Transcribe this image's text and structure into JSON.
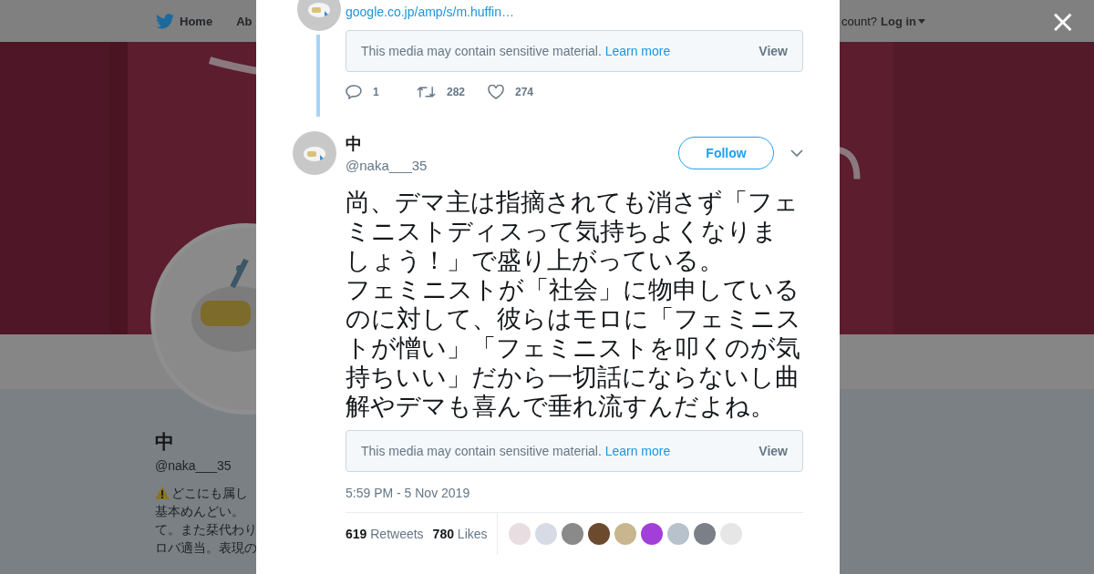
{
  "background_page": {
    "nav": [
      {
        "label": "Home",
        "selected": false
      },
      {
        "label": "Ab",
        "selected": false
      }
    ],
    "login_prompt": "count?",
    "login": "Log in",
    "profile": {
      "name": "中",
      "handle": "@naka___35",
      "bio_lines": [
        "どこにも属し",
        "基本めんどい。",
        "て。また栞代わり",
        "ロバ適当。表現の"
      ]
    }
  },
  "modal": {
    "close": "×",
    "previous_tweet": {
      "link": "google.co.jp/amp/s/m.huffin…",
      "sensitive": {
        "text": "This media may contain sensitive material.",
        "link": "Learn more",
        "button": "View"
      },
      "actions": [
        {
          "kind": "reply",
          "count": "1"
        },
        {
          "kind": "retweet",
          "count": "282"
        },
        {
          "kind": "like",
          "count": "274"
        }
      ]
    },
    "tweet": {
      "name": "中",
      "handle": "@naka___35",
      "follow": "Follow",
      "text_paragraphs": [
        "尚、デマ主は指摘されても消さず「フェミニストディスって気持ちよくなりましょう！」で盛り上がっている。",
        "フェミニストが「社会」に物申しているのに対して、彼らはモロに「フェミニストが憎い」「フェミニストを叩くのが気持ちいい」だから一切話にならないし曲解やデマも喜んで垂れ流すんだよね。"
      ],
      "sensitive": {
        "text": "This media may contain sensitive material.",
        "link": "Learn more",
        "button": "View"
      },
      "time": "5:59 PM - 5 Nov 2019",
      "retweets": "619",
      "retweets_label": "Retweets",
      "likes": "780",
      "likes_label": "Likes",
      "likers": [
        {
          "color": "#e8dde0"
        },
        {
          "color": "#d6dbe6"
        },
        {
          "color": "#8a8a8a"
        },
        {
          "color": "#6b4a2e"
        },
        {
          "color": "#c9b58e"
        },
        {
          "color": "#a13fd8"
        },
        {
          "color": "#b8c2cc"
        },
        {
          "color": "#7a7f88"
        },
        {
          "color": "#e6e6e6"
        }
      ]
    }
  }
}
